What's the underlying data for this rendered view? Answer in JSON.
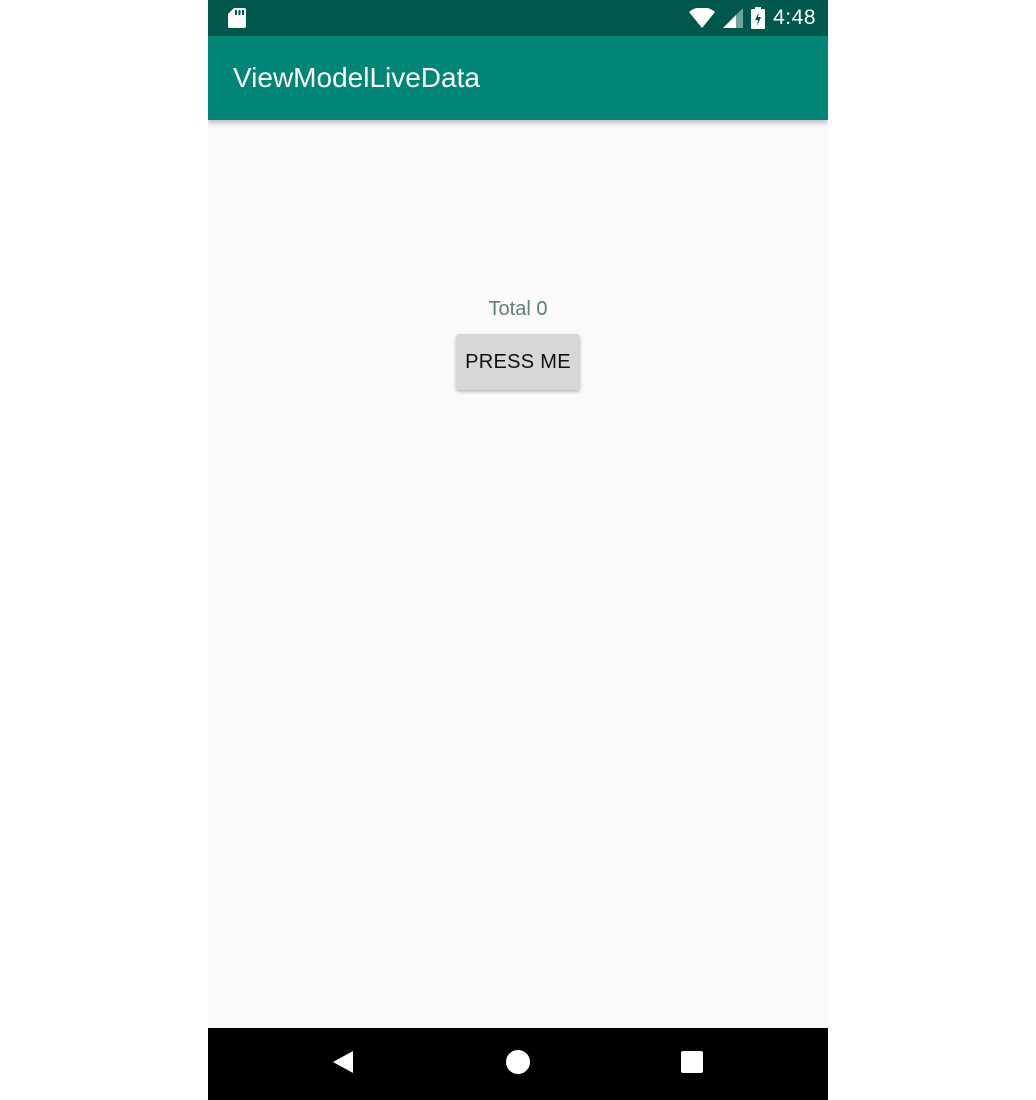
{
  "status_bar": {
    "time": "4:48",
    "icons": [
      "sd-card-icon",
      "wifi-icon",
      "cell-signal-icon",
      "battery-charging-icon"
    ],
    "background": "#00574b"
  },
  "app_bar": {
    "title": "ViewModelLiveData",
    "background": "#008577"
  },
  "main": {
    "total_label": "Total 0",
    "button_label": "PRESS ME"
  },
  "nav_bar": {
    "icons": [
      "back-icon",
      "home-icon",
      "recents-icon"
    ]
  }
}
